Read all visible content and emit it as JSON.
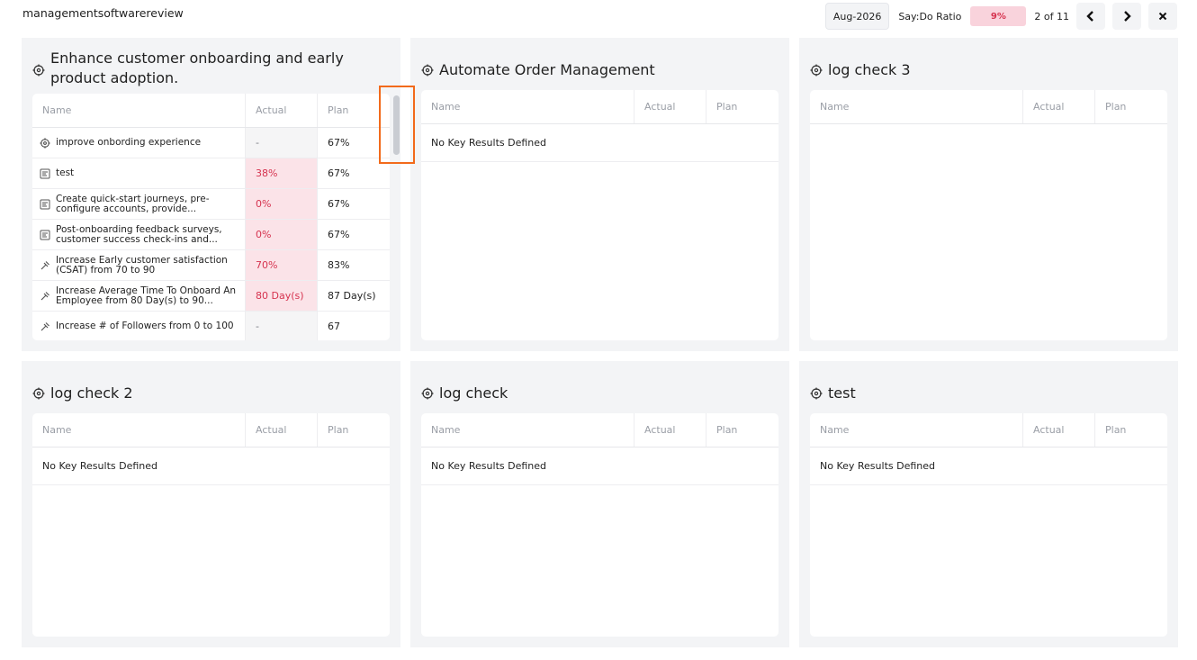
{
  "app": {
    "title": "managementsoftwarereview"
  },
  "topbar": {
    "period": "Aug-2026",
    "saydo_label": "Say:Do Ratio",
    "saydo_value": "9%",
    "pager": "2 of 11",
    "prev_icon": "‹",
    "next_icon": "›",
    "close_icon": "✕"
  },
  "columns": {
    "name": "Name",
    "actual": "Actual",
    "plan": "Plan"
  },
  "empty_text": "No Key Results Defined",
  "panels": [
    {
      "title": "Enhance customer onboarding and early product adoption.",
      "rows": [
        {
          "icon": "target-icon",
          "name": "improve onbording experience",
          "actual": "-",
          "plan": "67%"
        },
        {
          "icon": "task-icon",
          "name": "test",
          "actual": "38%",
          "plan": "67%"
        },
        {
          "icon": "task-icon",
          "name": "Create quick-start journeys, pre-configure accounts, provide...",
          "actual": "0%",
          "plan": "67%"
        },
        {
          "icon": "task-icon",
          "name": "Post-onboarding feedback surveys, customer success check-ins and...",
          "actual": "0%",
          "plan": "67%"
        },
        {
          "icon": "key-result-icon",
          "name": "Increase Early customer satisfaction (CSAT) from 70 to 90",
          "actual": "70%",
          "plan": "83%"
        },
        {
          "icon": "key-result-icon",
          "name": "Increase Average Time To Onboard An Employee from 80 Day(s) to 90...",
          "actual": "80 Day(s)",
          "plan": "87 Day(s)"
        },
        {
          "icon": "key-result-icon",
          "name": "Increase # of Followers from 0 to 100",
          "actual": "-",
          "plan": "67"
        }
      ]
    },
    {
      "title": "Automate Order Management"
    },
    {
      "title": "log check 3"
    },
    {
      "title": "log check 2"
    },
    {
      "title": "log check"
    },
    {
      "title": "test"
    }
  ],
  "colors": {
    "accent_red": "#d6334f",
    "badge_bg": "#f9d3dc",
    "highlight": "#f26a1b"
  }
}
